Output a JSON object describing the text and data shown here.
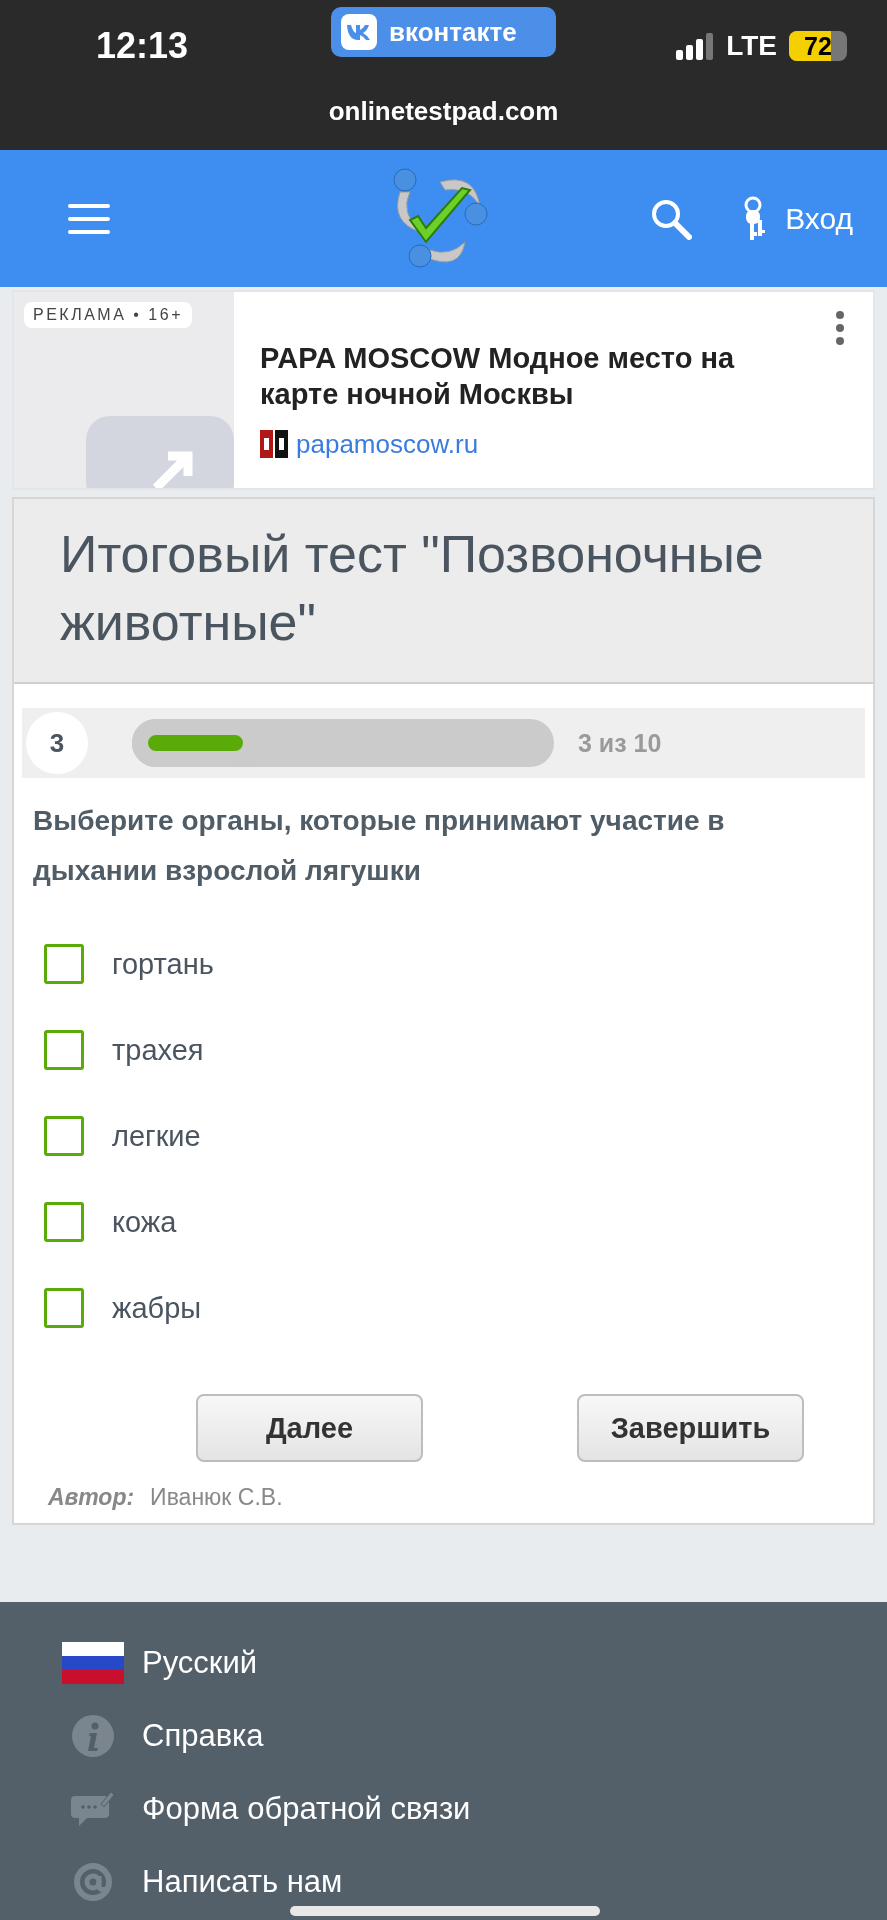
{
  "status_bar": {
    "time": "12:13",
    "app_badge": "вконтакте",
    "network": "LTE",
    "battery": "72"
  },
  "url": "onlinetestpad.com",
  "header": {
    "login": "Вход"
  },
  "ad": {
    "label": "РЕКЛАМА • 16+",
    "title": "PAPA MOSCOW Модное место на карте ночной Москвы",
    "domain": "papamoscow.ru"
  },
  "test": {
    "title": "Итоговый тест \"Позвоночные животные\"",
    "question_number": "3",
    "progress": {
      "level": 0.3,
      "text": "3 из 10"
    },
    "question": "Выберите органы, которые принимают участие в дыхании взрослой лягушки",
    "options": [
      {
        "label": "гортань",
        "checked": false
      },
      {
        "label": "трахея",
        "checked": false
      },
      {
        "label": "легкие",
        "checked": false
      },
      {
        "label": "кожа",
        "checked": false
      },
      {
        "label": "жабры",
        "checked": false
      }
    ],
    "buttons": [
      "Далее",
      "Завершить"
    ],
    "author_label": "Автор:",
    "author": "Иванюк С.В."
  },
  "footer": [
    {
      "kind": "language",
      "label": "Русский"
    },
    {
      "kind": "help",
      "label": "Справка"
    },
    {
      "kind": "feedback",
      "label": "Форма обратной связи"
    },
    {
      "kind": "email",
      "label": "Написать нам"
    }
  ]
}
